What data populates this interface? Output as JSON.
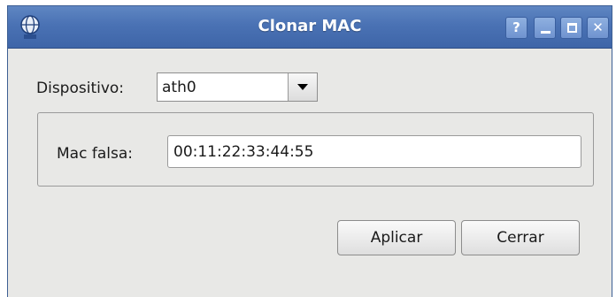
{
  "window": {
    "title": "Clonar MAC",
    "help_label": "?",
    "close_label": "✕"
  },
  "device": {
    "label": "Dispositivo:",
    "selected": "ath0"
  },
  "mac": {
    "label": "Mac falsa:",
    "value": "00:11:22:33:44:55"
  },
  "buttons": {
    "apply": "Aplicar",
    "close": "Cerrar"
  },
  "colors": {
    "titlebar": "#4a72b4",
    "window_bg": "#e8e8e6"
  },
  "icons": {
    "app": "network-globe-icon",
    "dropdown": "chevron-down-icon"
  }
}
